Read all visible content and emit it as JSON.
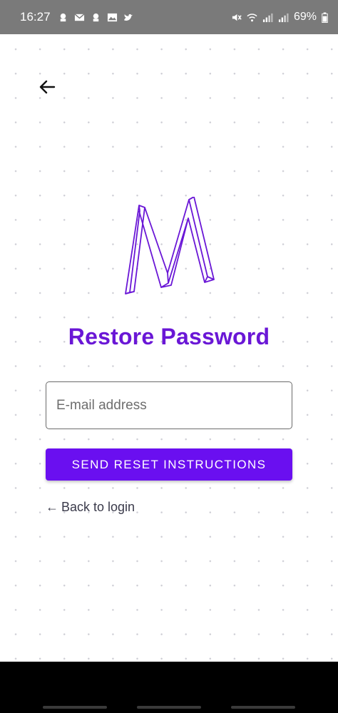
{
  "status_bar": {
    "time": "16:27",
    "battery": "69%",
    "left_icons": [
      "notification-icon",
      "gmail-icon",
      "notification-icon",
      "gallery-icon",
      "twitter-icon"
    ],
    "right_icons": [
      "mute-icon",
      "wifi-icon",
      "signal-icon",
      "signal-icon",
      "battery-icon"
    ]
  },
  "header": {
    "back_icon": "arrow-left-icon"
  },
  "logo": {
    "letter": "M",
    "color": "#6a17d6"
  },
  "title": "Restore Password",
  "form": {
    "email_placeholder": "E-mail address",
    "email_value": "",
    "send_button": "SEND RESET INSTRUCTIONS"
  },
  "back_to_login": {
    "arrow": "←",
    "label": "Back to login"
  },
  "colors": {
    "accent": "#6a0ff0",
    "title": "#6a17d6",
    "status_bar": "#7a7a7a"
  }
}
